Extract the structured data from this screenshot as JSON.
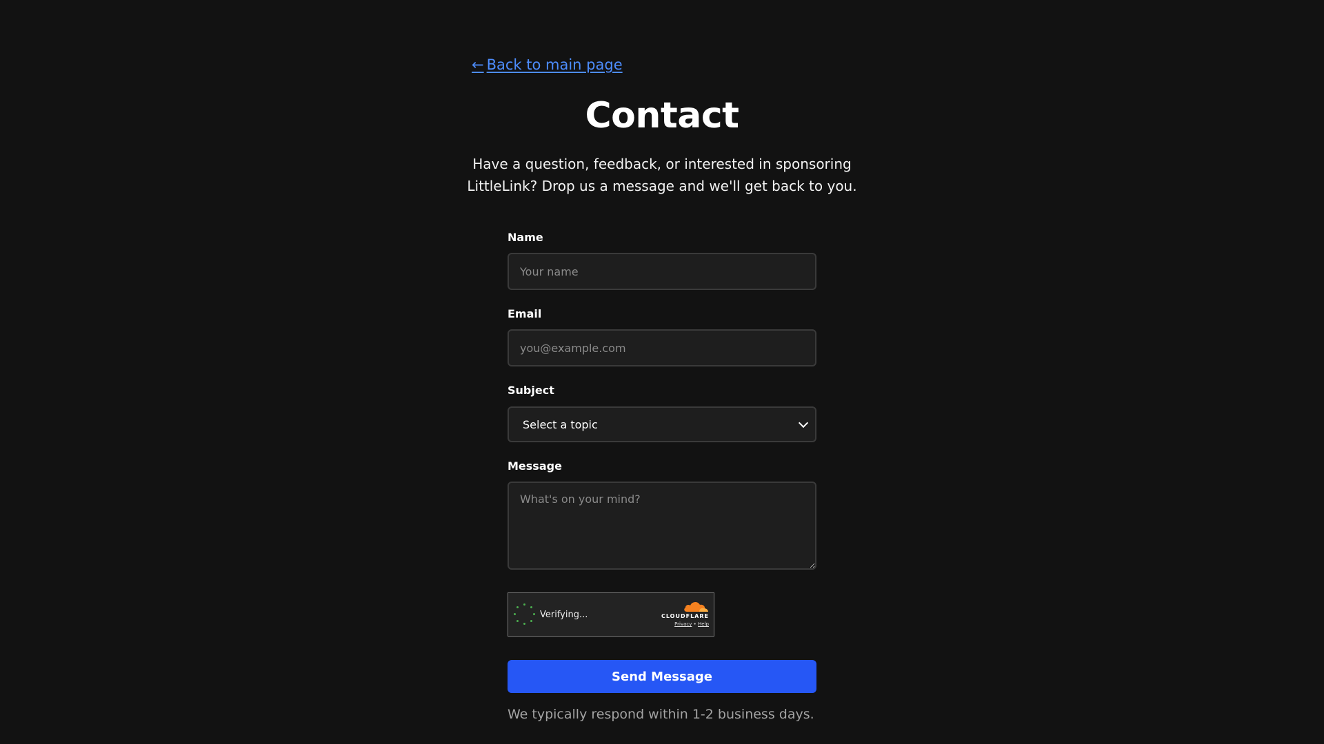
{
  "nav": {
    "back_arrow": "←",
    "back_label": "Back to main page"
  },
  "header": {
    "title": "Contact",
    "intro": "Have a question, feedback, or interested in sponsoring LittleLink? Drop us a message and we'll get back to you."
  },
  "form": {
    "name": {
      "label": "Name",
      "placeholder": "Your name",
      "value": ""
    },
    "email": {
      "label": "Email",
      "placeholder": "you@example.com",
      "value": ""
    },
    "subject": {
      "label": "Subject",
      "selected": "Select a topic"
    },
    "message": {
      "label": "Message",
      "placeholder": "What's on your mind?",
      "value": ""
    },
    "captcha": {
      "status": "Verifying...",
      "brand": "CLOUDFLARE",
      "privacy": "Privacy",
      "separator": "•",
      "help": "Help"
    },
    "submit_label": "Send Message",
    "note": "We typically respond within 1-2 business days."
  },
  "colors": {
    "background": "#121212",
    "link": "#4d8dff",
    "primary_button": "#2657f5",
    "spinner": "#4caf50",
    "cloudflare_orange": "#f48120"
  }
}
